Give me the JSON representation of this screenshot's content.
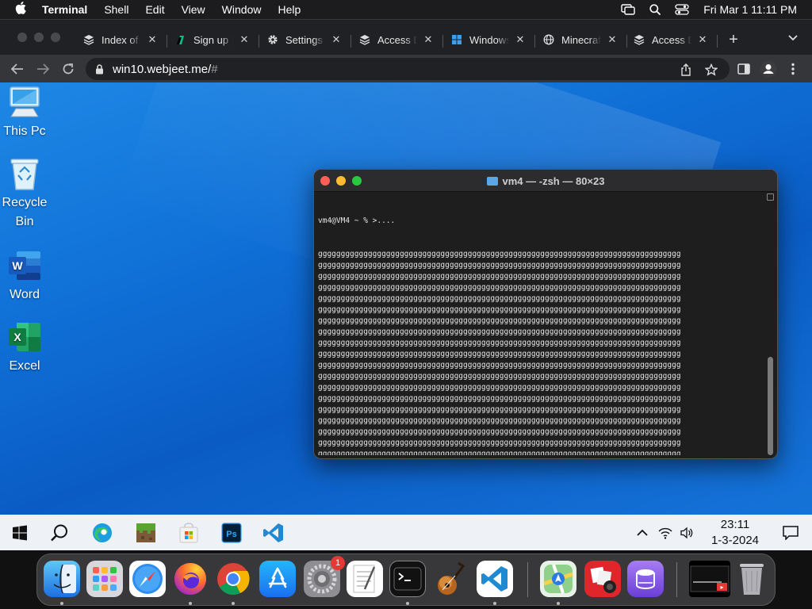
{
  "menubar": {
    "app_name": "Terminal",
    "items": [
      "Shell",
      "Edit",
      "View",
      "Window",
      "Help"
    ],
    "clock": "Fri Mar 1  11:11 PM"
  },
  "browser": {
    "tabs": [
      {
        "label": "Index of /",
        "icon": "server-icon"
      },
      {
        "label": "Sign up | ",
        "icon": "signup-icon"
      },
      {
        "label": "Settings",
        "icon": "gear-icon"
      },
      {
        "label": "Access D",
        "icon": "server-icon"
      },
      {
        "label": "Windows",
        "icon": "windows-icon"
      },
      {
        "label": "Minecraft",
        "icon": "globe-icon"
      },
      {
        "label": "Access D",
        "icon": "server-icon"
      }
    ],
    "url_host": "win10.webjeet.me/",
    "url_hash": "#"
  },
  "desktop": {
    "icons": [
      {
        "label": "This Pc",
        "icon": "computer-icon"
      },
      {
        "label": "Recycle Bin",
        "icon": "recycle-bin-icon"
      },
      {
        "label": "Word",
        "icon": "word-icon"
      },
      {
        "label": "Excel",
        "icon": "excel-icon"
      }
    ]
  },
  "terminal": {
    "title": "vm4 — -zsh — 80×23",
    "prompt": "vm4@VM4 ~ % >....",
    "fill_line": "gggggggggggggggggggggggggggggggggggggggggggggggggggggggggggggggggggggggggggggggg",
    "last_line": "gggggggggggggggggggggggggggggggggggggggggggggggggggggggggggggggggggggggggggggggggg",
    "fill_line_count": 21
  },
  "taskbar": {
    "time": "23:11",
    "date": "1-3-2024"
  },
  "dock": {
    "settings_badge": "1"
  }
}
